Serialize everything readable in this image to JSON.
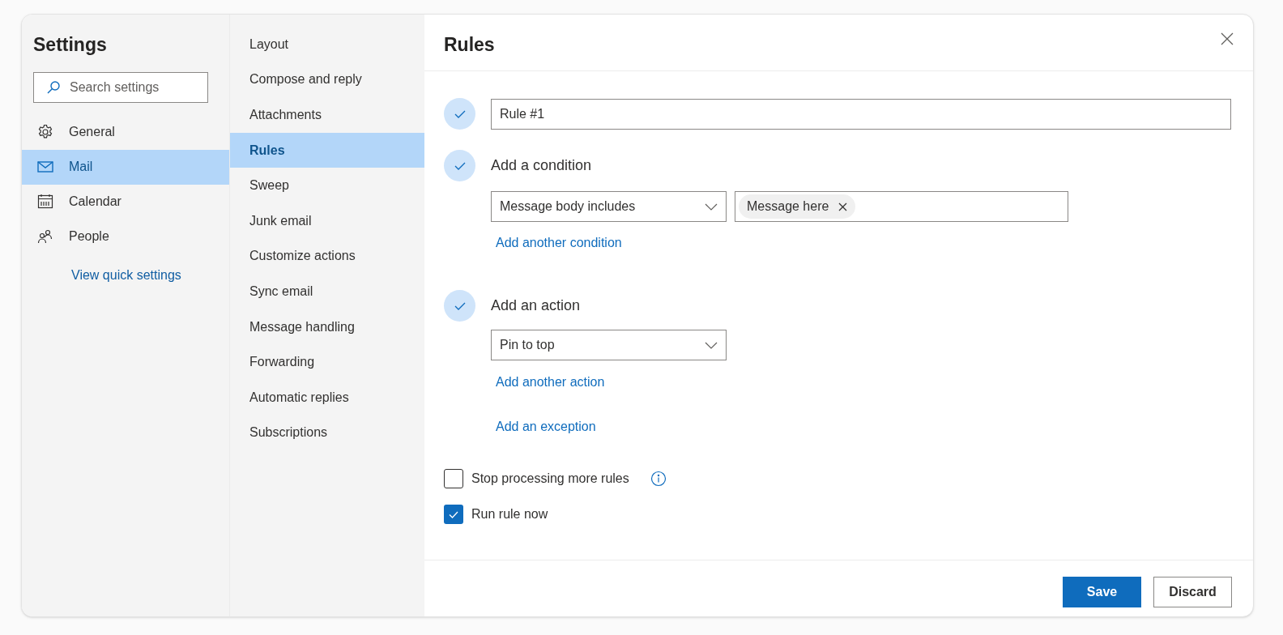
{
  "sidebar": {
    "title": "Settings",
    "search": {
      "placeholder": "Search settings"
    },
    "items": [
      {
        "label": "General",
        "selected": false
      },
      {
        "label": "Mail",
        "selected": true
      },
      {
        "label": "Calendar",
        "selected": false
      },
      {
        "label": "People",
        "selected": false
      }
    ],
    "link": "View quick settings"
  },
  "subnav": {
    "items": [
      {
        "label": "Layout",
        "selected": false
      },
      {
        "label": "Compose and reply",
        "selected": false
      },
      {
        "label": "Attachments",
        "selected": false
      },
      {
        "label": "Rules",
        "selected": true
      },
      {
        "label": "Sweep",
        "selected": false
      },
      {
        "label": "Junk email",
        "selected": false
      },
      {
        "label": "Customize actions",
        "selected": false
      },
      {
        "label": "Sync email",
        "selected": false
      },
      {
        "label": "Message handling",
        "selected": false
      },
      {
        "label": "Forwarding",
        "selected": false
      },
      {
        "label": "Automatic replies",
        "selected": false
      },
      {
        "label": "Subscriptions",
        "selected": false
      }
    ]
  },
  "panel": {
    "title": "Rules",
    "rule_name": "Rule #1",
    "condition": {
      "heading": "Add a condition",
      "dropdown": "Message body includes",
      "tags": [
        "Message here"
      ],
      "link": "Add another condition"
    },
    "action": {
      "heading": "Add an action",
      "dropdown": "Pin to top",
      "link": "Add another action"
    },
    "exception_link": "Add an exception",
    "options": [
      {
        "label": "Stop processing more rules",
        "checked": false,
        "info": true
      },
      {
        "label": "Run rule now",
        "checked": true,
        "info": false
      }
    ],
    "buttons": [
      {
        "label": "Save",
        "kind": "primary"
      },
      {
        "label": "Discard",
        "kind": "secondary"
      }
    ]
  }
}
